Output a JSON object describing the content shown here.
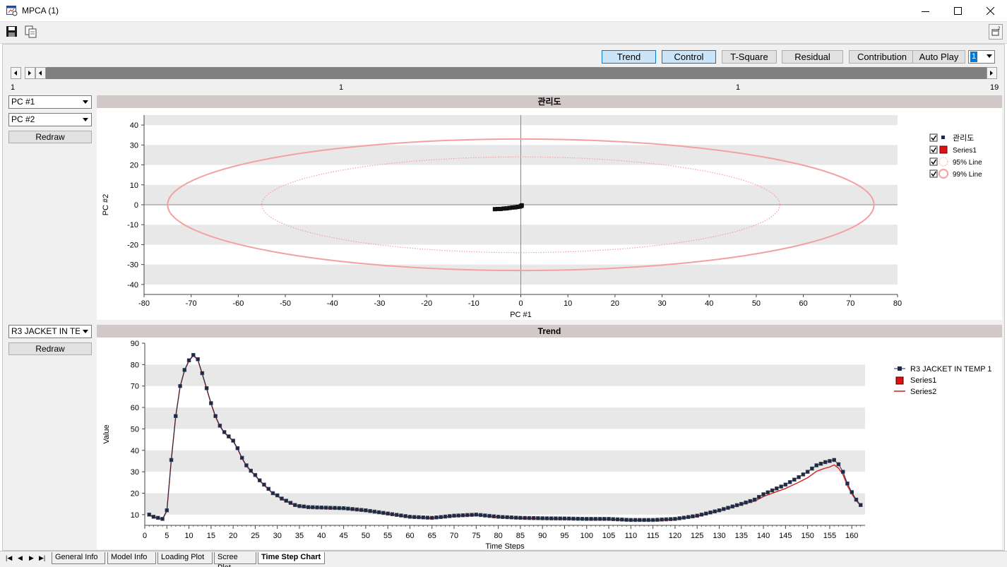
{
  "window": {
    "title": "MPCA (1)"
  },
  "modes": [
    {
      "label": "Trend",
      "active": true
    },
    {
      "label": "Control",
      "active": true
    },
    {
      "label": "T-Square",
      "active": false
    },
    {
      "label": "Residual",
      "active": false
    },
    {
      "label": "Contribution",
      "active": false
    },
    {
      "label": "Auto Play",
      "active": false
    }
  ],
  "speed_value": "1",
  "scrollbar": {
    "min": "1",
    "pos_a": "1",
    "pos_b": "1",
    "max": "19"
  },
  "control_panel": {
    "x_select": "PC #1",
    "y_select": "PC #2",
    "redraw_label": "Redraw",
    "title": "관리도"
  },
  "trend_panel": {
    "var_select": "R3 JACKET IN TE",
    "redraw_label": "Redraw",
    "title": "Trend"
  },
  "tabs": [
    "General Info",
    "Model Info",
    "Loading Plot",
    "Scree Plot",
    "Time Step Chart"
  ],
  "active_tab": "Time Step Chart",
  "colors": {
    "limit": "#f4a0a0",
    "trend_marker": "#1b2a4a",
    "series2": "#d21f1f",
    "band": "#e8e8e8",
    "active_btn": "#cce4f7"
  },
  "chart_data": [
    {
      "type": "scatter",
      "title": "관리도",
      "xlabel": "PC #1",
      "ylabel": "PC #2",
      "xlim": [
        -80,
        80
      ],
      "ylim": [
        -45,
        45
      ],
      "xticks": [
        -80,
        -70,
        -60,
        -50,
        -40,
        -30,
        -20,
        -10,
        0,
        10,
        20,
        30,
        40,
        50,
        60,
        70,
        80
      ],
      "yticks": [
        -40,
        -30,
        -20,
        -10,
        0,
        10,
        20,
        30,
        40
      ],
      "legend": [
        "관리도",
        "Series1",
        "95% Line",
        "99% Line"
      ],
      "legend_position": "right",
      "limits": {
        "limit_95": {
          "center": [
            0,
            0
          ],
          "semi_x": 55,
          "semi_y": 24
        },
        "limit_99": {
          "center": [
            0,
            0
          ],
          "semi_x": 75,
          "semi_y": 33
        }
      },
      "points": [
        [
          -5.5,
          -2.2
        ],
        [
          -4.9,
          -2.1
        ],
        [
          -4.3,
          -2.1
        ],
        [
          -3.6,
          -1.9
        ],
        [
          -3.0,
          -1.8
        ],
        [
          -2.4,
          -1.6
        ],
        [
          -1.8,
          -1.4
        ],
        [
          -1.2,
          -1.3
        ],
        [
          -0.7,
          -1.1
        ],
        [
          -0.2,
          -0.9
        ],
        [
          0.1,
          -0.6
        ],
        [
          0.2,
          -0.3
        ]
      ]
    },
    {
      "type": "line",
      "title": "Trend",
      "xlabel": "Time Steps",
      "ylabel": "Value",
      "xlim": [
        0,
        163
      ],
      "ylim": [
        5,
        90
      ],
      "yticks": [
        10,
        20,
        30,
        40,
        50,
        60,
        70,
        80,
        90
      ],
      "xtick_step": 5,
      "legend_position": "right",
      "series": [
        {
          "name": "R3 JACKET IN TEMP 1",
          "style": "line-marker"
        },
        {
          "name": "Series1",
          "style": "marker"
        },
        {
          "name": "Series2",
          "style": "line"
        }
      ],
      "keypoints": [
        [
          1,
          10
        ],
        [
          2,
          9
        ],
        [
          3,
          8.5
        ],
        [
          4,
          8
        ],
        [
          5,
          12
        ],
        [
          6,
          35.5
        ],
        [
          7,
          56
        ],
        [
          8,
          70
        ],
        [
          9,
          77.5
        ],
        [
          10,
          82
        ],
        [
          11,
          84.5
        ],
        [
          12,
          82.5
        ],
        [
          13,
          76
        ],
        [
          14,
          69
        ],
        [
          15,
          62
        ],
        [
          16,
          56
        ],
        [
          17,
          51.5
        ],
        [
          18,
          48.5
        ],
        [
          19,
          46.5
        ],
        [
          20,
          44.5
        ],
        [
          21,
          41
        ],
        [
          22,
          36.5
        ],
        [
          23,
          33
        ],
        [
          24,
          30.5
        ],
        [
          25,
          28.5
        ],
        [
          26,
          26
        ],
        [
          27,
          24
        ],
        [
          28,
          22
        ],
        [
          29,
          20
        ],
        [
          30,
          19
        ],
        [
          31,
          17.5
        ],
        [
          32,
          16.5
        ],
        [
          33,
          15.5
        ],
        [
          34,
          14.5
        ],
        [
          35,
          14
        ],
        [
          36,
          13.8
        ],
        [
          37,
          13.5
        ],
        [
          40,
          13.3
        ],
        [
          45,
          13
        ],
        [
          50,
          12
        ],
        [
          55,
          10.5
        ],
        [
          60,
          9
        ],
        [
          65,
          8.5
        ],
        [
          70,
          9.5
        ],
        [
          75,
          10
        ],
        [
          80,
          9
        ],
        [
          85,
          8.5
        ],
        [
          90,
          8.3
        ],
        [
          95,
          8.2
        ],
        [
          100,
          8
        ],
        [
          105,
          8
        ],
        [
          110,
          7.5
        ],
        [
          115,
          7.5
        ],
        [
          120,
          8
        ],
        [
          125,
          9.5
        ],
        [
          130,
          12
        ],
        [
          135,
          15
        ],
        [
          138,
          17
        ],
        [
          140,
          19.5
        ],
        [
          145,
          24
        ],
        [
          148,
          27.5
        ],
        [
          150,
          30
        ],
        [
          152,
          33
        ],
        [
          154,
          34.5
        ],
        [
          155,
          35
        ],
        [
          156,
          35.5
        ],
        [
          157,
          33.5
        ],
        [
          158,
          30
        ],
        [
          159,
          24.5
        ],
        [
          160,
          20.5
        ],
        [
          161,
          17
        ],
        [
          162,
          14.5
        ]
      ],
      "series2_offset": [
        [
          1,
          0
        ],
        [
          135,
          0
        ],
        [
          145,
          -1.5
        ],
        [
          150,
          -2.5
        ],
        [
          155,
          -2.5
        ],
        [
          156,
          -2
        ],
        [
          158,
          -1
        ],
        [
          162,
          0
        ]
      ]
    }
  ]
}
